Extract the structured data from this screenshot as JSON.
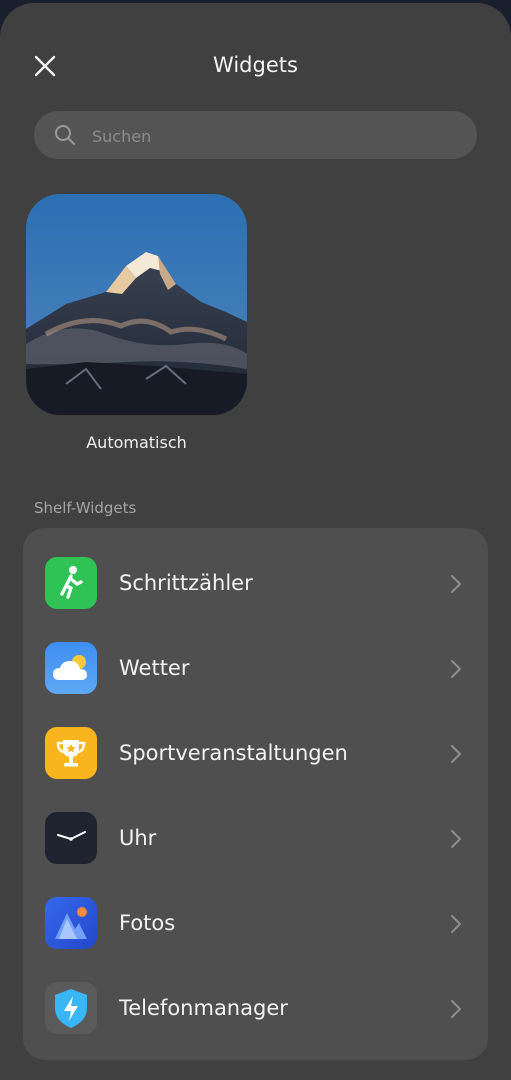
{
  "header": {
    "title": "Widgets",
    "close_icon": "close-icon"
  },
  "search": {
    "placeholder": "Suchen",
    "value": "",
    "icon": "search-icon"
  },
  "wallpaper": {
    "label": "Automatisch",
    "image": "mountain-peak-photo"
  },
  "section": {
    "label": "Shelf-Widgets"
  },
  "items": [
    {
      "label": "Schrittzähler",
      "icon": "pedometer-icon",
      "color": "#2fc255"
    },
    {
      "label": "Wetter",
      "icon": "weather-icon",
      "color": "#3b8ef0"
    },
    {
      "label": "Sportveranstaltungen",
      "icon": "trophy-icon",
      "color": "#f9b51e"
    },
    {
      "label": "Uhr",
      "icon": "clock-icon",
      "color": "#1f2430"
    },
    {
      "label": "Fotos",
      "icon": "photos-icon",
      "color": "#2c5be0"
    },
    {
      "label": "Telefonmanager",
      "icon": "phone-manager-icon",
      "color": "#39b6f5"
    }
  ]
}
